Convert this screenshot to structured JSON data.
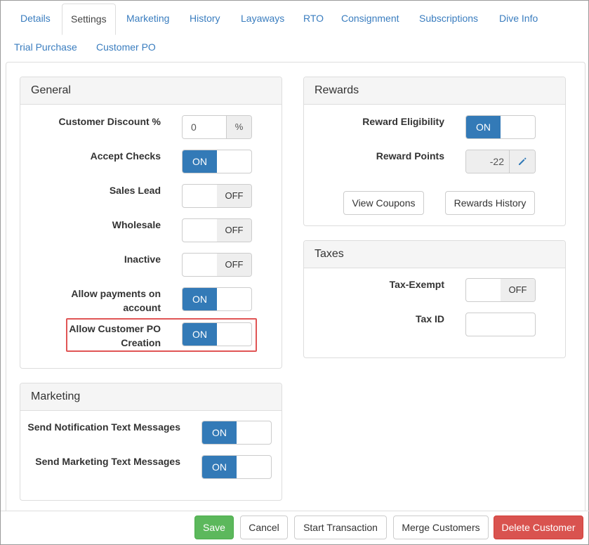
{
  "tabs": [
    {
      "label": "Details",
      "active": false
    },
    {
      "label": "Settings",
      "active": true
    },
    {
      "label": "Marketing",
      "active": false
    },
    {
      "label": "History",
      "active": false
    },
    {
      "label": "Layaways",
      "active": false
    },
    {
      "label": "RTO",
      "active": false
    },
    {
      "label": "Consignment",
      "active": false
    },
    {
      "label": "Subscriptions",
      "active": false
    },
    {
      "label": "Dive Info",
      "active": false
    },
    {
      "label": "Trial Purchase",
      "active": false
    },
    {
      "label": "Customer PO",
      "active": false
    }
  ],
  "general": {
    "title": "General",
    "customer_discount": {
      "label": "Customer Discount %",
      "value": "0",
      "addon": "%"
    },
    "accept_checks": {
      "label": "Accept Checks",
      "state": "ON"
    },
    "sales_lead": {
      "label": "Sales Lead",
      "state": "OFF"
    },
    "wholesale": {
      "label": "Wholesale",
      "state": "OFF"
    },
    "inactive": {
      "label": "Inactive",
      "state": "OFF"
    },
    "allow_payments": {
      "label_line1": "Allow payments on",
      "label_line2": "account",
      "state": "ON"
    },
    "allow_customer_po": {
      "label_line1": "Allow Customer PO",
      "label_line2": "Creation",
      "state": "ON"
    }
  },
  "marketing": {
    "title": "Marketing",
    "notification_texts": {
      "label": "Send Notification Text Messages",
      "state": "ON"
    },
    "marketing_texts": {
      "label": "Send Marketing Text Messages",
      "state": "ON"
    }
  },
  "rewards": {
    "title": "Rewards",
    "eligibility": {
      "label": "Reward Eligibility",
      "state": "ON"
    },
    "points": {
      "label": "Reward Points",
      "value": "-22"
    },
    "view_coupons_label": "View Coupons",
    "rewards_history_label": "Rewards History"
  },
  "taxes": {
    "title": "Taxes",
    "tax_exempt": {
      "label": "Tax-Exempt",
      "state": "OFF"
    },
    "tax_id": {
      "label": "Tax ID",
      "value": ""
    }
  },
  "footer": {
    "save": "Save",
    "cancel": "Cancel",
    "start_transaction": "Start Transaction",
    "merge_customers": "Merge Customers",
    "delete_customer": "Delete Customer"
  },
  "colors": {
    "primary": "#337ab7",
    "link": "#3a7dbf",
    "success": "#5cb85c",
    "danger": "#d9534f",
    "highlight": "#e05555"
  },
  "icons": {
    "edit_points": "pencil-icon"
  }
}
